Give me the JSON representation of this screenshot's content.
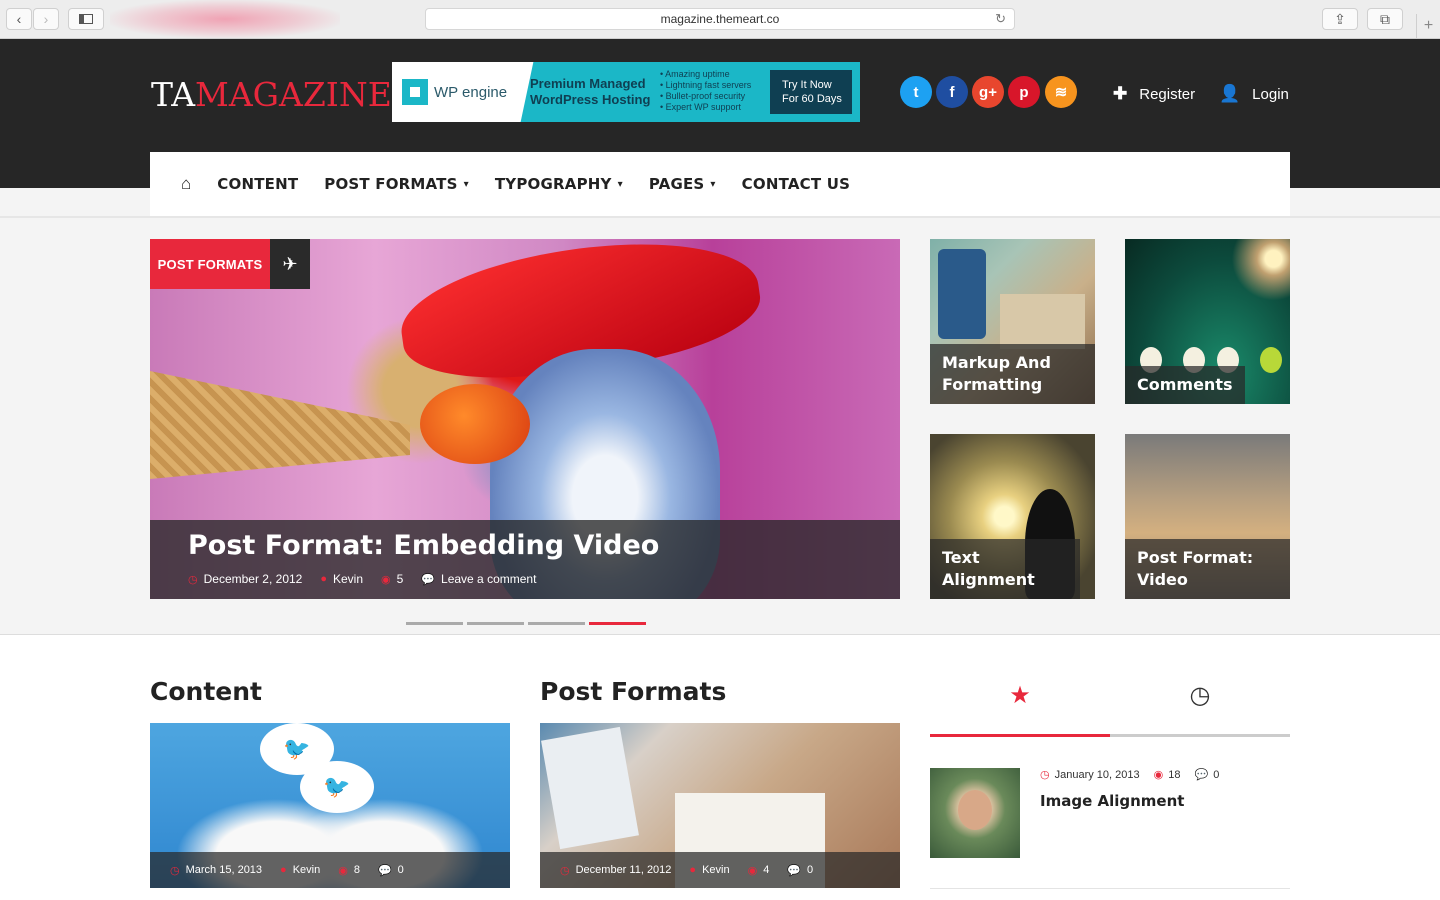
{
  "browser": {
    "url": "magazine.themeart.co",
    "back_icon": "‹",
    "forward_icon": "›",
    "reload_icon": "↻",
    "newtab_icon": "+"
  },
  "site": {
    "logo_part1": "TA",
    "logo_part2": "MAGAZINE",
    "brand_color": "#e8283c"
  },
  "ad": {
    "brand": "WP engine",
    "headline_line1": "Premium Managed",
    "headline_line2": "WordPress Hosting",
    "bullets": [
      "• Amazing uptime",
      "• Lightning fast servers",
      "• Bullet-proof security",
      "• Expert WP support"
    ],
    "cta_line1": "Try It Now",
    "cta_line2": "For 60 Days"
  },
  "social": [
    {
      "name": "twitter",
      "glyph": "t",
      "color": "#1da1f2"
    },
    {
      "name": "facebook",
      "glyph": "f",
      "color": "#1f4ea1"
    },
    {
      "name": "google-plus",
      "glyph": "g+",
      "color": "#e8462e"
    },
    {
      "name": "pinterest",
      "glyph": "p",
      "color": "#d8162a"
    },
    {
      "name": "rss",
      "glyph": "≋",
      "color": "#f7941e"
    }
  ],
  "account": {
    "register_label": "Register",
    "login_label": "Login"
  },
  "nav": {
    "home_icon": "home-icon",
    "items": [
      "CONTENT",
      "POST FORMATS",
      "TYPOGRAPHY",
      "PAGES",
      "CONTACT US"
    ]
  },
  "hero": {
    "category": "POST FORMATS",
    "title": "Post Format: Embedding Video",
    "date": "December 2, 2012",
    "author": "Kevin",
    "views": "5",
    "comments": "Leave a comment",
    "active_slide_index": 3,
    "slide_count": 4
  },
  "thumbs": [
    {
      "title_line1": "Markup And",
      "title_line2": "Formatting"
    },
    {
      "title_line1": "Comments",
      "title_line2": ""
    },
    {
      "title_line1": "Text Alignment",
      "title_line2": ""
    },
    {
      "title_line1": "Post Format:",
      "title_line2": "Video"
    }
  ],
  "sections": {
    "content_title": "Content",
    "post_formats_title": "Post Formats"
  },
  "cards": [
    {
      "date": "March 15, 2013",
      "author": "Kevin",
      "views": "8",
      "comments": "0"
    },
    {
      "date": "December 11, 2012",
      "author": "Kevin",
      "views": "4",
      "comments": "0"
    }
  ],
  "sidebar": {
    "tabs": [
      "popular-star-icon",
      "recent-clock-icon"
    ],
    "popular": [
      {
        "date": "January 10, 2013",
        "views": "18",
        "comments": "0",
        "title": "Image Alignment"
      }
    ]
  }
}
